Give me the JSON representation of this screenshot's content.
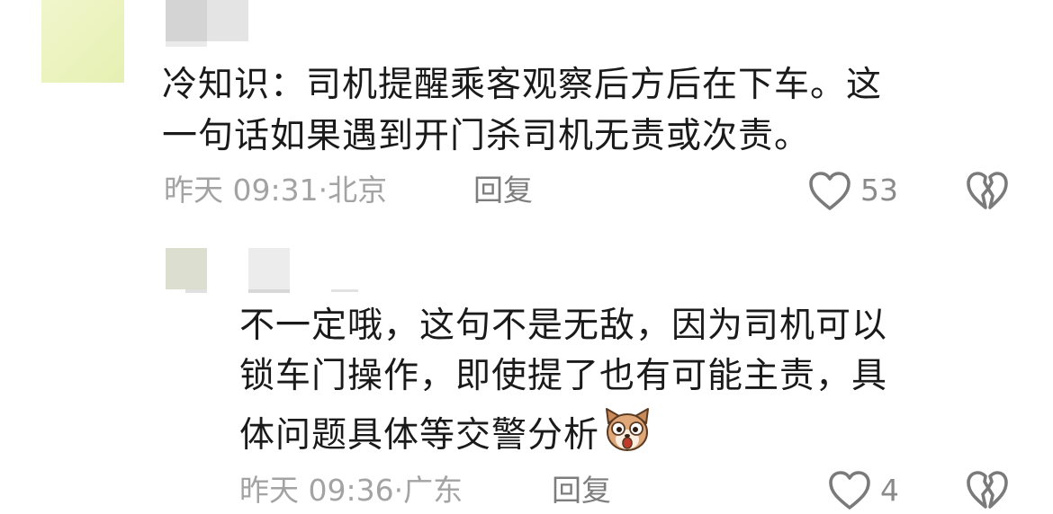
{
  "comments": [
    {
      "text_line1": "冷知识：司机提醒乘客观察后方后在下车。这",
      "text_line2": "一句话如果遇到开门杀司机无责或次责。",
      "timestamp": "昨天 09:31·",
      "location": "北京",
      "reply_label": "回复",
      "like_count": "53"
    },
    {
      "text_line1": "不一定哦，这句不是无敌，因为司机可以",
      "text_line2": "锁车门操作，即使提了也有可能主责，具",
      "text_line3": "体问题具体等交警分析",
      "timestamp": "昨天 09:36·",
      "location": "广东",
      "reply_label": "回复",
      "like_count": "4"
    }
  ],
  "icons": {
    "like": "heart-outline-icon",
    "dislike": "broken-heart-icon",
    "emoji": "dog-face-emoji-icon"
  },
  "colors": {
    "text": "#1a1a1a",
    "meta": "#a3a3a3",
    "reply": "#7d7d7d",
    "icon": "#7a7a7a"
  }
}
